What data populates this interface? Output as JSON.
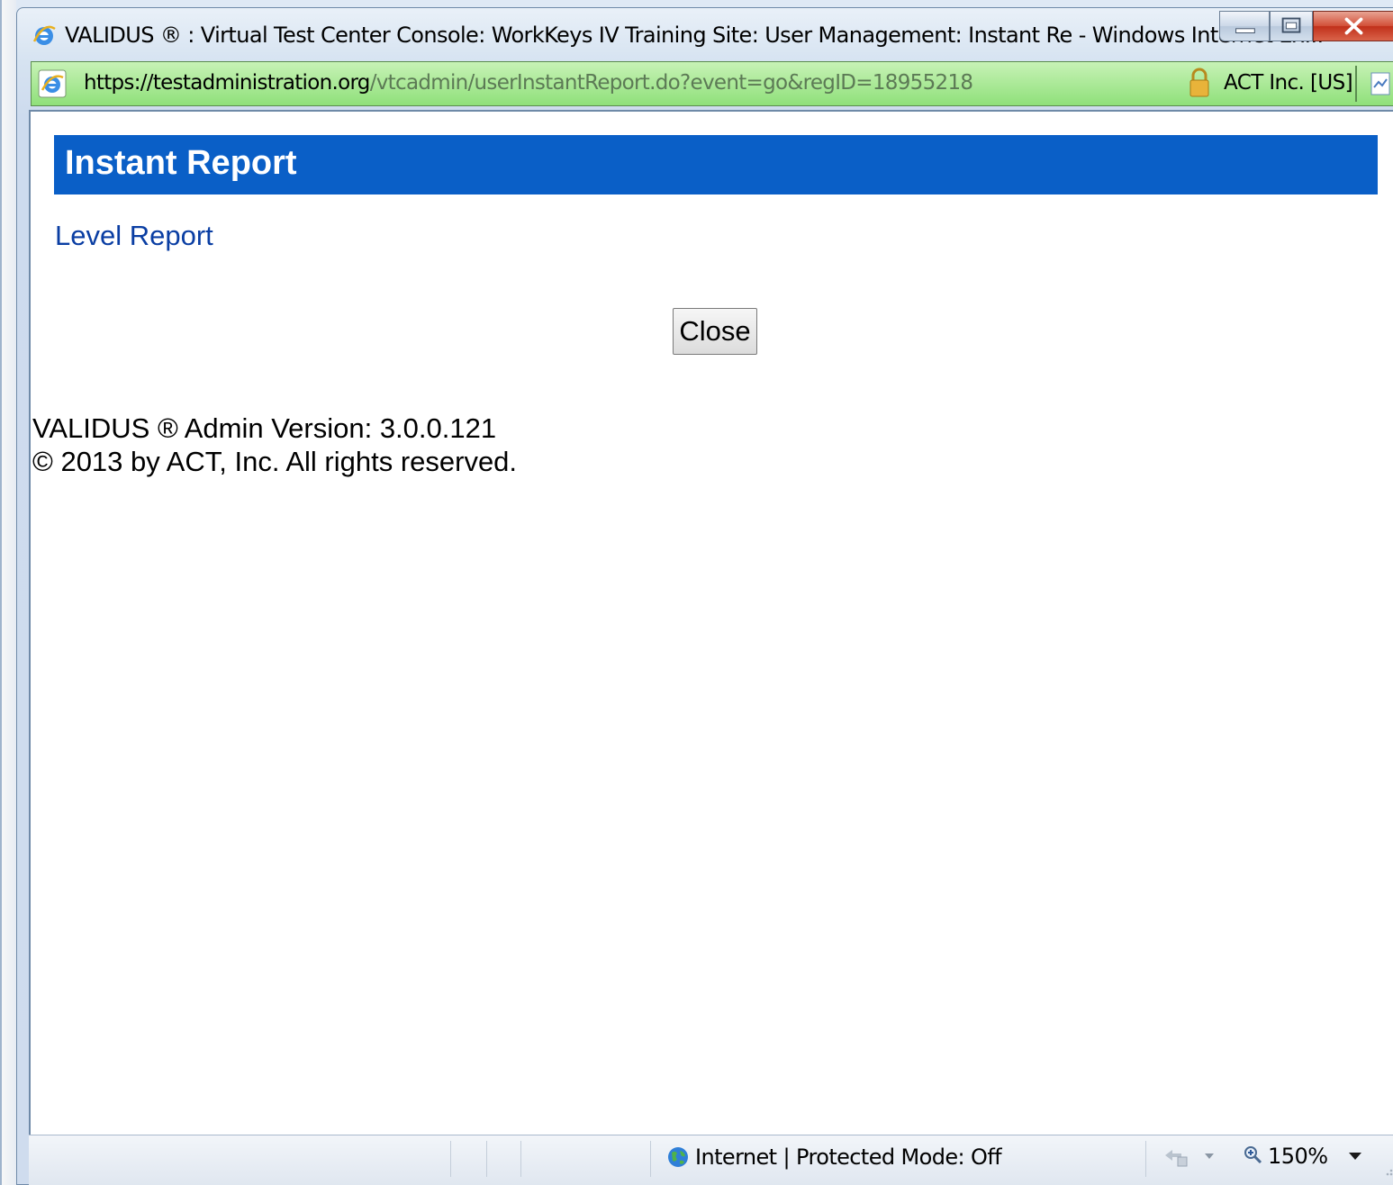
{
  "window": {
    "title": "VALIDUS ® : Virtual Test Center Console: WorkKeys IV Training Site: User Management: Instant Re - Windows Internet Ex...",
    "controls": {
      "minimize_icon": "minimize-icon",
      "maximize_icon": "maximize-icon",
      "close_icon": "close-icon"
    }
  },
  "address_bar": {
    "url_protocol": "https://",
    "url_host": "testadministration.org",
    "url_path": "/vtcadmin/userInstantReport.do?event=go&regID=18955218",
    "certificate": "ACT Inc. [US]"
  },
  "page": {
    "header_title": "Instant Report",
    "header_color": "#0a5fc7",
    "level_report_link": "Level Report",
    "close_button": "Close",
    "footer_version": "VALIDUS ® Admin Version: 3.0.0.121",
    "footer_copyright": "© 2013 by ACT, Inc. All rights reserved."
  },
  "status_bar": {
    "zone_text": "Internet | Protected Mode: Off",
    "zoom": "150%"
  }
}
